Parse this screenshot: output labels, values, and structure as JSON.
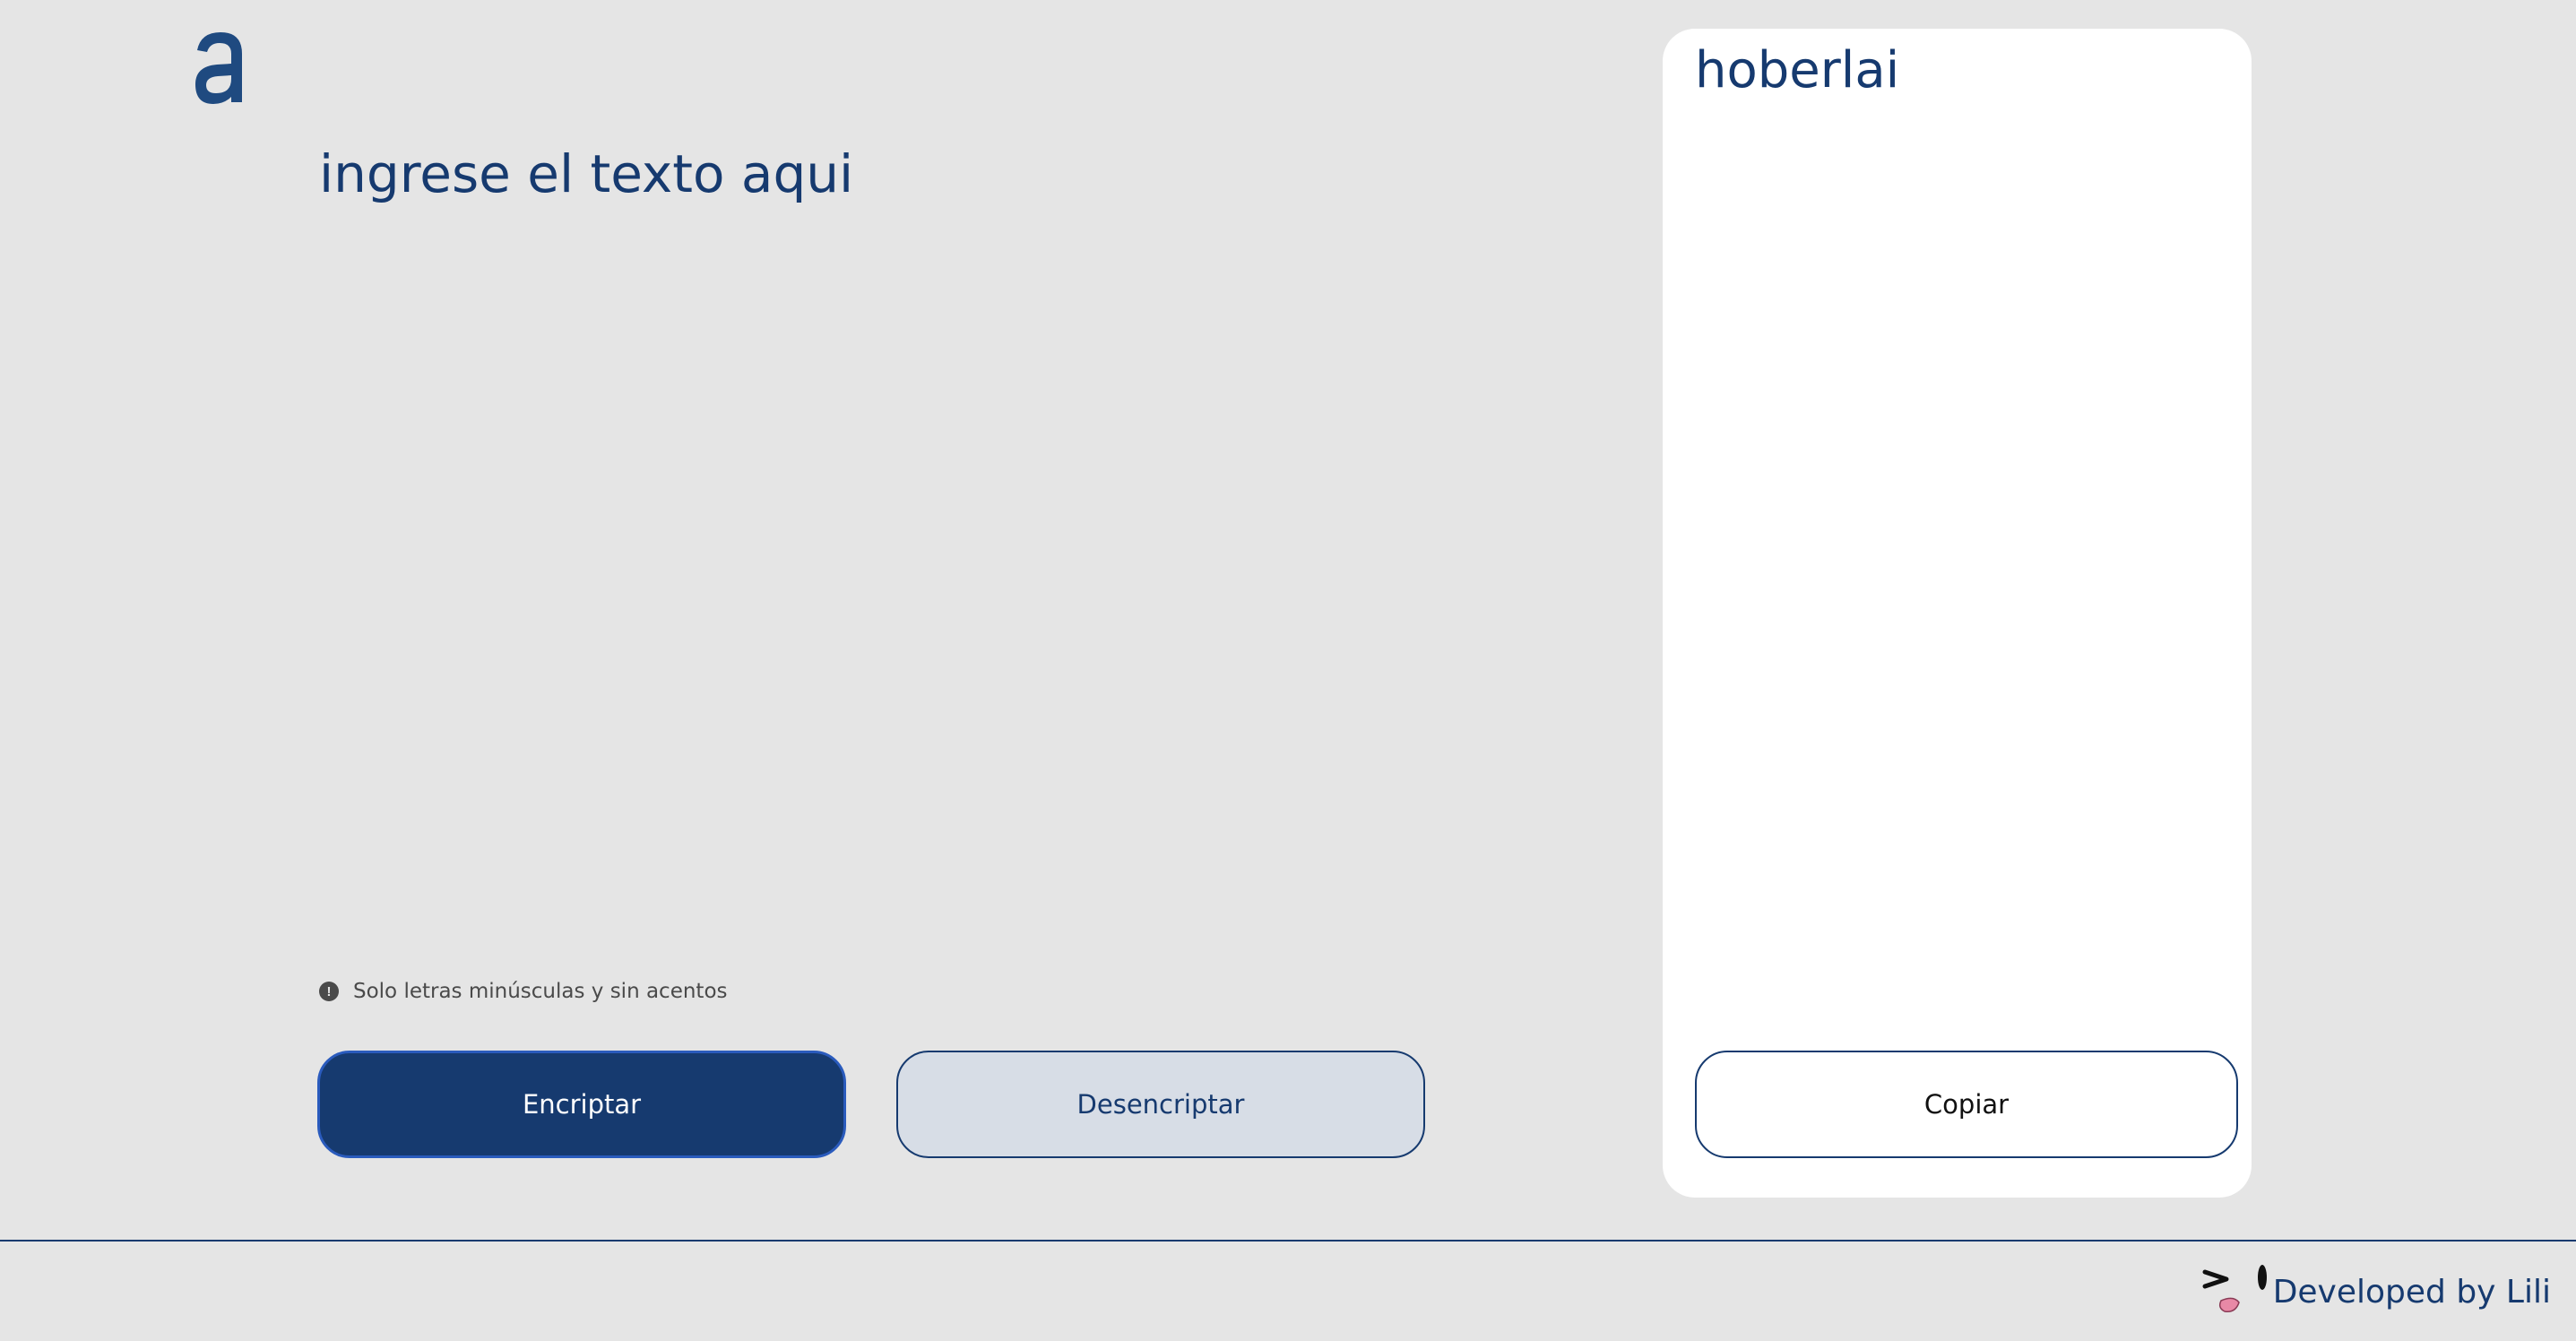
{
  "app": {
    "logo_icon": "alura-a-logo"
  },
  "input": {
    "placeholder": "ingrese el texto aqui",
    "value": ""
  },
  "hint": {
    "icon": "info-icon",
    "icon_glyph": "!",
    "text": "Solo letras minúsculas y sin acentos"
  },
  "actions": {
    "encrypt_label": "Encriptar",
    "decrypt_label": "Desencriptar"
  },
  "result": {
    "text": "hoberlai",
    "copy_label": "Copiar"
  },
  "footer": {
    "credit": "Developed by Lili",
    "mascot_icon": "winking-face-icon"
  },
  "colors": {
    "background": "#e5e5e5",
    "primary": "#163a6f",
    "secondary_button": "#d7dde6",
    "panel": "#ffffff"
  }
}
